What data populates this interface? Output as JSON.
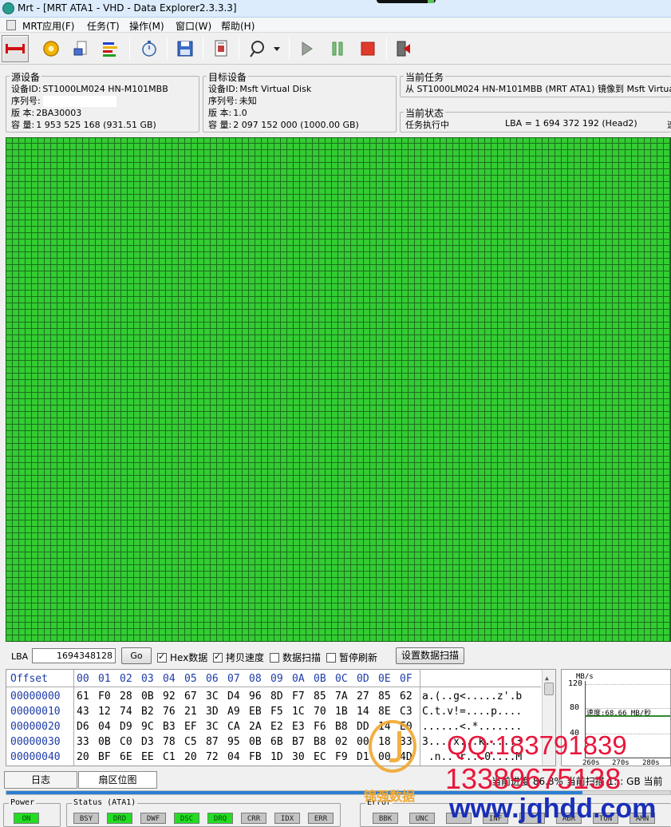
{
  "window": {
    "title": "Mrt - [MRT ATA1 - VHD - Data Explorer2.3.3.3]"
  },
  "menu": [
    "MRT应用(F)",
    "任务(T)",
    "操作(M)",
    "窗口(W)",
    "帮助(H)"
  ],
  "source_device": {
    "legend": "源设备",
    "device_id_label": "设备ID:",
    "device_id": "ST1000LM024 HN-M101MBB",
    "serial_label": "序列号:",
    "version_label": "版   本:",
    "version": "2BA30003",
    "capacity_label": "容   量:",
    "capacity": "1 953 525 168 (931.51 GB)"
  },
  "target_device": {
    "legend": "目标设备",
    "device_id_label": "设备ID:",
    "device_id": "Msft Virtual Disk",
    "serial_label": "序列号:",
    "serial": "未知",
    "version_label": "版   本:",
    "version": "1.0",
    "capacity_label": "容   量:",
    "capacity": "2 097 152 000 (1000.00 GB)"
  },
  "current_task": {
    "legend": "当前任务",
    "text": "从 ST1000LM024 HN-M101MBB (MRT ATA1) 镜像到 Msft Virtual Disk"
  },
  "current_status": {
    "legend": "当前状态",
    "state": "任务执行中",
    "lba": "LBA = 1 694 372 192 (Head2)",
    "truncated": "速"
  },
  "lba_bar": {
    "label": "LBA",
    "value": "1694348128",
    "go": "Go",
    "hex_checkbox": "Hex数据",
    "hex_checked": true,
    "copy_speed": "拷贝速度",
    "copy_speed_checked": true,
    "data_scan": "数据扫描",
    "data_scan_checked": false,
    "pause_refresh": "暂停刷新",
    "pause_refresh_checked": false,
    "scan_settings": "设置数据扫描"
  },
  "hex": {
    "offset_header": "Offset",
    "columns": [
      "00",
      "01",
      "02",
      "03",
      "04",
      "05",
      "06",
      "07",
      "08",
      "09",
      "0A",
      "0B",
      "0C",
      "0D",
      "0E",
      "0F"
    ],
    "rows": [
      {
        "offset": "00000000",
        "bytes": [
          "61",
          "F0",
          "28",
          "0B",
          "92",
          "67",
          "3C",
          "D4",
          "96",
          "8D",
          "F7",
          "85",
          "7A",
          "27",
          "85",
          "62"
        ],
        "ascii": "a.(..g<.....z'.b"
      },
      {
        "offset": "00000010",
        "bytes": [
          "43",
          "12",
          "74",
          "B2",
          "76",
          "21",
          "3D",
          "A9",
          "EB",
          "F5",
          "1C",
          "70",
          "1B",
          "14",
          "8E",
          "C3"
        ],
        "ascii": "C.t.v!=....p...."
      },
      {
        "offset": "00000020",
        "bytes": [
          "D6",
          "04",
          "D9",
          "9C",
          "B3",
          "EF",
          "3C",
          "CA",
          "2A",
          "E2",
          "E3",
          "F6",
          "B8",
          "DD",
          "14",
          "E0"
        ],
        "ascii": "......<.*......."
      },
      {
        "offset": "00000030",
        "bytes": [
          "33",
          "0B",
          "C0",
          "D3",
          "78",
          "C5",
          "87",
          "95",
          "0B",
          "6B",
          "B7",
          "B8",
          "02",
          "00",
          "18",
          "33"
        ],
        "ascii": "3....x...k.....3"
      },
      {
        "offset": "00000040",
        "bytes": [
          "20",
          "BF",
          "6E",
          "EE",
          "C1",
          "20",
          "72",
          "04",
          "FB",
          "1D",
          "30",
          "EC",
          "F9",
          "D1",
          "00",
          "4D"
        ],
        "ascii": " .n.. r...0....M"
      }
    ]
  },
  "speed_graph": {
    "unit": "MB/s",
    "ticks": [
      "120",
      "80",
      "40"
    ],
    "speed_text": "速度:68.66 MB/秒",
    "x_ticks": [
      "260s",
      "270s",
      "280s"
    ]
  },
  "tabs": [
    "日志",
    "扇区位图"
  ],
  "status_line": "当前进度 86.8% 当前扫描 1:::  GB 当前",
  "progress_pct": 86.8,
  "power": {
    "legend": "Power",
    "leds": [
      {
        "label": "ON",
        "on": true
      }
    ]
  },
  "status": {
    "legend": "Status (ATA1)",
    "leds": [
      {
        "label": "BSY",
        "on": false
      },
      {
        "label": "DRD",
        "on": true
      },
      {
        "label": "DWF",
        "on": false
      },
      {
        "label": "DSC",
        "on": true
      },
      {
        "label": "DRQ",
        "on": true
      },
      {
        "label": "CRR",
        "on": false
      },
      {
        "label": "IDX",
        "on": false
      },
      {
        "label": "ERR",
        "on": false
      }
    ]
  },
  "error": {
    "legend": "Error",
    "leds": [
      {
        "label": "BBK",
        "on": false
      },
      {
        "label": "UNC",
        "on": false
      },
      {
        "label": "",
        "on": false
      },
      {
        "label": "INF",
        "on": false
      },
      {
        "label": "",
        "on": false
      },
      {
        "label": "ABR",
        "on": false
      },
      {
        "label": "TON",
        "on": false
      },
      {
        "label": "AMN",
        "on": false
      }
    ]
  },
  "watermark": {
    "qq": "QQ:183791839",
    "phone": "13389675138",
    "url": "www.jqhdd.com",
    "brand": "锦强数据"
  },
  "colors": {
    "sector_ok": "#33cc33",
    "led_on": "#22dd22",
    "progress": "#2b7fd3",
    "watermark_red": "#e8173b",
    "watermark_blue": "#1a2fb8"
  }
}
